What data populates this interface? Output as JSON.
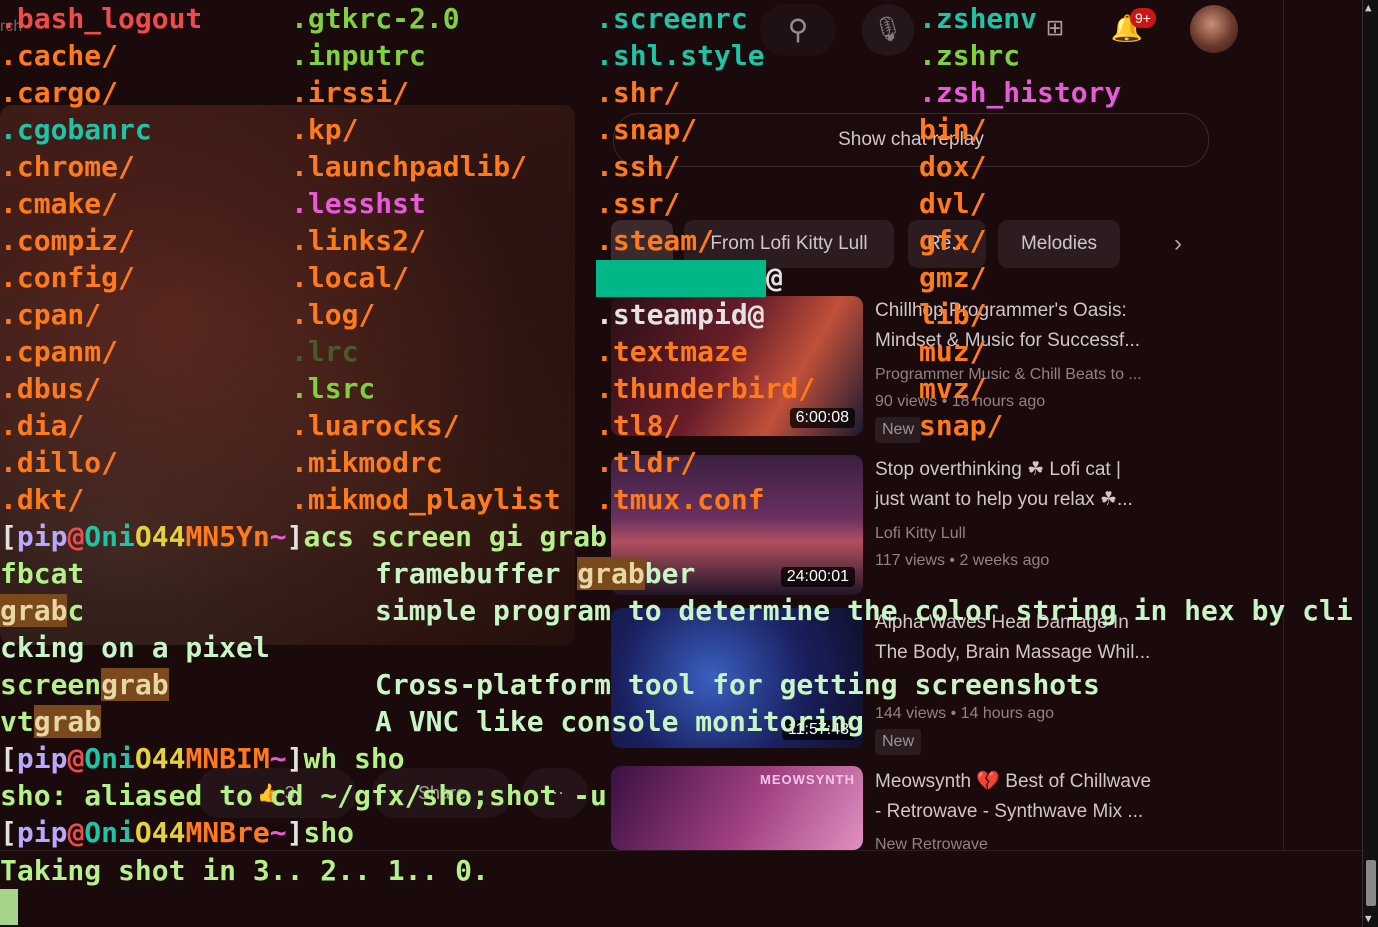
{
  "background": {
    "search_label": "rch",
    "search_icon": "search-icon",
    "mic_icon": "mic-icon",
    "notifications_badge": "9+",
    "chat_replay_label": "Show chat replay",
    "chips": [
      "",
      "From Lofi Kitty Lull",
      "Re...",
      "Melodies"
    ],
    "videos": [
      {
        "title_line1": "Chillhop Programmer's Oasis:",
        "title_line2": "Mindset & Music for Successf...",
        "channel": "Programmer Music & Chill Beats to ...",
        "meta": "90 views  • 18 hours ago",
        "badge": "New",
        "duration": "6:00:08"
      },
      {
        "title_line1": "Stop overthinking ☘ Lofi cat |",
        "title_line2": "just want to help you relax ☘...",
        "channel": "Lofi Kitty Lull",
        "meta": "117 views  • 2 weeks ago",
        "badge": "",
        "duration": "24:00:01"
      },
      {
        "title_line1": "Alpha Waves Heal Damage In",
        "title_line2": "The Body, Brain Massage Whil...",
        "channel": "",
        "meta": "144 views  • 14 hours ago",
        "badge": "New",
        "duration": "11:57:43"
      },
      {
        "title_line1": "Meowsynth 💔 Best of Chillwave",
        "title_line2": "- Retrowave - Synthwave Mix ...",
        "channel": "New Retrowave",
        "meta": "",
        "badge": "",
        "duration": "",
        "thumb_label": "MEOWSYNTH"
      }
    ],
    "actions": {
      "like": "👍  3",
      "share": "Share",
      "more": "⋯"
    }
  },
  "terminal": {
    "listing": {
      "col1": [
        ".bash_logout",
        ".cache/",
        ".cargo/",
        ".cgobanrc",
        ".chrome/",
        ".cmake/",
        ".compiz/",
        ".config/",
        ".cpan/",
        ".cpanm/",
        ".dbus/",
        ".dia/",
        ".dillo/",
        ".dkt/"
      ],
      "col2": [
        ".gtkrc-2.0",
        ".inputrc",
        ".irssi/",
        ".kp/",
        ".launchpadlib/",
        ".lesshst",
        ".links2/",
        ".local/",
        ".log/",
        ".lrc",
        ".lsrc",
        ".luarocks/",
        ".mikmodrc",
        ".mikmod_playlist"
      ],
      "col3": [
        ".screenrc",
        ".shl.style",
        ".shr/",
        ".snap/",
        ".ssh/",
        ".ssr/",
        ".steam/",
        "@",
        ".steampid@",
        ".textmaze",
        ".thunderbird/",
        ".tl8/",
        ".tldr/",
        ".tmux.conf"
      ],
      "col4": [
        ".zshenv",
        ".zshrc",
        ".zsh_history",
        "bin/",
        "dox/",
        "dvl/",
        "gfx/",
        "gmz/",
        "lib/",
        "muz/",
        "mvz/",
        "snap/"
      ]
    },
    "prompt1": {
      "user": "pip",
      "at": "@",
      "host1": "Oni",
      "host2": "O44",
      "host3": "MN5Yn",
      "tilde": "~",
      "cmd": "acs screen gi grab"
    },
    "results": [
      {
        "name_pre": "fbcat",
        "name_hl": "",
        "name_post": "",
        "desc_pre": "framebuffer ",
        "desc_hl": "grab",
        "desc_post": "ber"
      },
      {
        "name_pre": "",
        "name_hl": "grab",
        "name_post": "c",
        "desc_pre": "simple program to determine the color string in hex by cli",
        "desc_hl": "",
        "desc_post": ""
      },
      {
        "wrap": "cking on a pixel"
      },
      {
        "name_pre": "screen",
        "name_hl": "grab",
        "name_post": "",
        "desc_pre": "Cross-platform tool for getting screenshots",
        "desc_hl": "",
        "desc_post": ""
      },
      {
        "name_pre": "vt",
        "name_hl": "grab",
        "name_post": "",
        "desc_pre": "A VNC like console monitoring",
        "desc_hl": "",
        "desc_post": ""
      }
    ],
    "prompt2": {
      "user": "pip",
      "at": "@",
      "host1": "Oni",
      "host2": "O44",
      "host3": "MNBIM",
      "tilde": "~",
      "cmd": "wh sho"
    },
    "alias_line": "sho: aliased to cd ~/gfx/sho;shot -u",
    "prompt3": {
      "user": "pip",
      "at": "@",
      "host1": "Oni",
      "host2": "O44",
      "host3": "MNBre",
      "tilde": "~",
      "cmd": "sho"
    },
    "status_line": "Taking shot in 3.. 2.. 1.. 0."
  },
  "colors": {
    "terminal_bg": "#1b0a0c",
    "redacted": "#00b787",
    "dir_orange": "#ff7a1a",
    "teal": "#1fc3a6",
    "match_highlight": "#7a4a1c"
  }
}
